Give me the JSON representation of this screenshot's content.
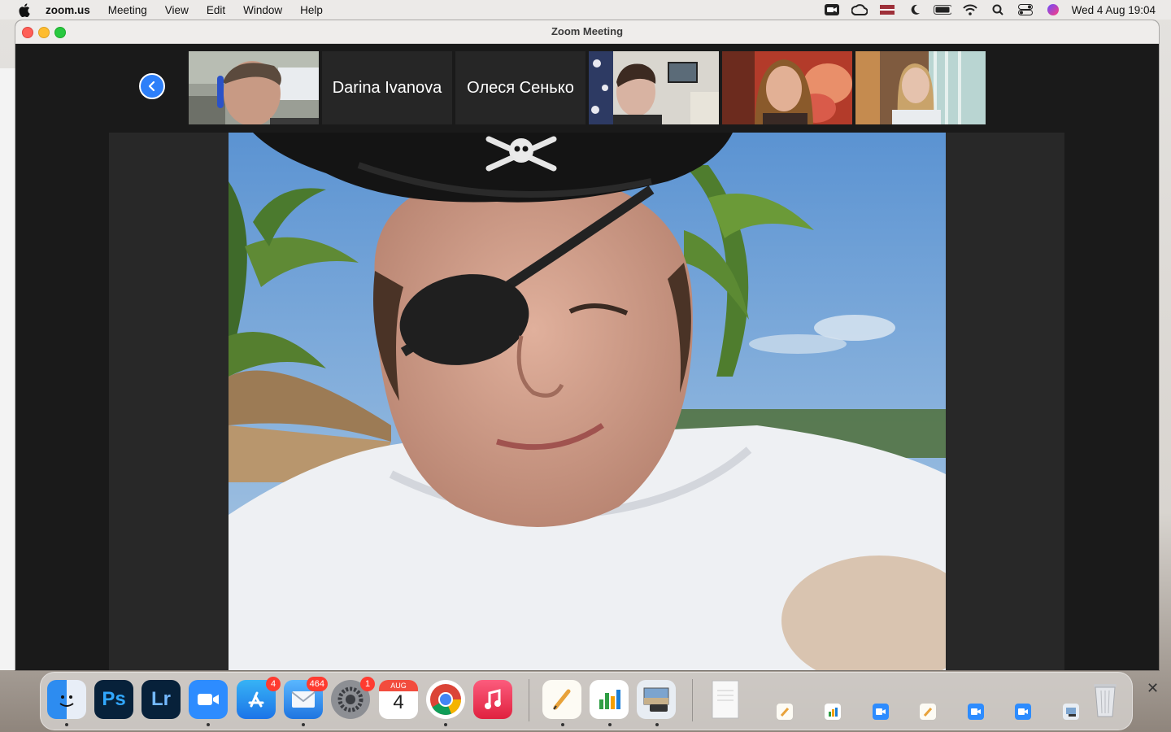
{
  "menubar": {
    "app_name": "zoom.us",
    "items": [
      "Meeting",
      "View",
      "Edit",
      "Window",
      "Help"
    ],
    "clock": "Wed 4 Aug  19:04"
  },
  "window": {
    "title": "Zoom Meeting"
  },
  "participants": [
    {
      "type": "video",
      "name": ""
    },
    {
      "type": "name",
      "name": "Darina Ivanova"
    },
    {
      "type": "name",
      "name": "Олеся Сенько"
    },
    {
      "type": "video",
      "name": ""
    },
    {
      "type": "video",
      "name": ""
    },
    {
      "type": "video",
      "name": ""
    }
  ],
  "dock": {
    "apps": [
      {
        "name": "Finder",
        "badge": ""
      },
      {
        "name": "Photoshop",
        "label": "Ps",
        "badge": ""
      },
      {
        "name": "Lightroom",
        "label": "Lr",
        "badge": ""
      },
      {
        "name": "Zoom",
        "badge": ""
      },
      {
        "name": "App Store",
        "badge": "4"
      },
      {
        "name": "Mail",
        "badge": "464"
      },
      {
        "name": "System Preferences",
        "badge": "1"
      },
      {
        "name": "Calendar",
        "month": "AUG",
        "day": "4",
        "badge": ""
      },
      {
        "name": "Chrome",
        "badge": ""
      },
      {
        "name": "Music",
        "badge": ""
      }
    ]
  },
  "colors": {
    "accent": "#2d7ff9",
    "badge": "#ff3b30",
    "window_bg": "#1a1a1a"
  }
}
